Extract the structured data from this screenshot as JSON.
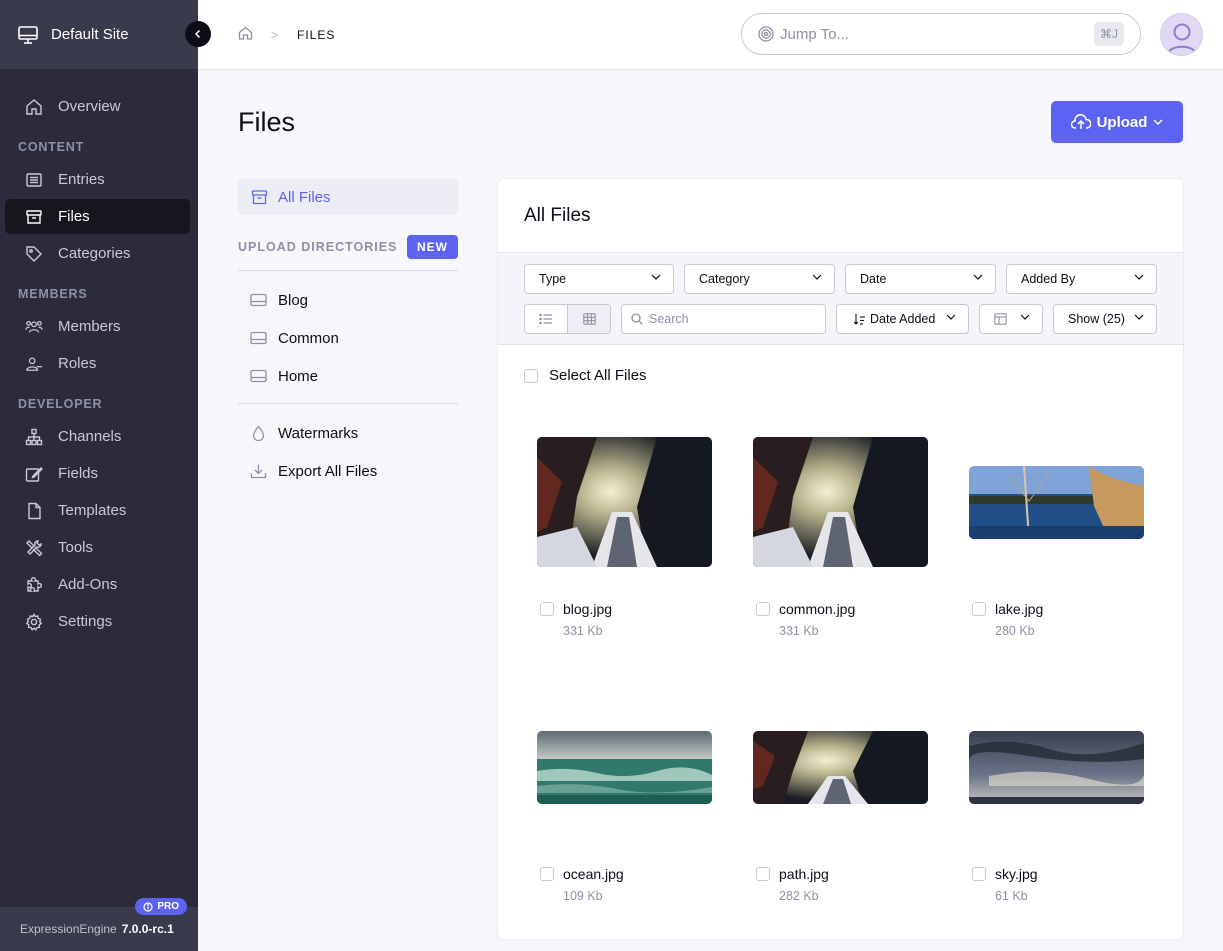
{
  "sidebar": {
    "site_name": "Default Site",
    "overview": "Overview",
    "sections": {
      "content": "CONTENT",
      "members": "MEMBERS",
      "developer": "DEVELOPER"
    },
    "items": {
      "entries": "Entries",
      "files": "Files",
      "categories": "Categories",
      "members": "Members",
      "roles": "Roles",
      "channels": "Channels",
      "fields": "Fields",
      "templates": "Templates",
      "tools": "Tools",
      "addons": "Add-Ons",
      "settings": "Settings"
    },
    "active_item": "Files",
    "footer": {
      "product": "ExpressionEngine",
      "version": "7.0.0-rc.1",
      "badge": "PRO"
    }
  },
  "topbar": {
    "breadcrumb": "FILES",
    "jump_placeholder": "Jump To...",
    "shortcut": "⌘J"
  },
  "page": {
    "title": "Files",
    "upload_label": "Upload"
  },
  "directories": {
    "all_files": "All Files",
    "upload_directories_label": "UPLOAD DIRECTORIES",
    "new_label": "NEW",
    "list": [
      "Blog",
      "Common",
      "Home"
    ],
    "watermarks": "Watermarks",
    "export_all": "Export All Files"
  },
  "files_panel": {
    "title": "All Files",
    "filters": {
      "type": "Type",
      "category": "Category",
      "date": "Date",
      "added_by": "Added By"
    },
    "search_placeholder": "Search",
    "sort_label": "Date Added",
    "show_label": "Show (25)",
    "view_mode": "grid",
    "select_all": "Select All Files",
    "files": [
      {
        "name": "blog.jpg",
        "size": "331 Kb"
      },
      {
        "name": "common.jpg",
        "size": "331 Kb"
      },
      {
        "name": "lake.jpg",
        "size": "280 Kb"
      },
      {
        "name": "ocean.jpg",
        "size": "109 Kb"
      },
      {
        "name": "path.jpg",
        "size": "282 Kb"
      },
      {
        "name": "sky.jpg",
        "size": "61 Kb"
      }
    ]
  },
  "colors": {
    "accent": "#5d63f1",
    "sidebar_bg": "#2b2b3b",
    "sidebar_header_bg": "#3a3a4d"
  }
}
